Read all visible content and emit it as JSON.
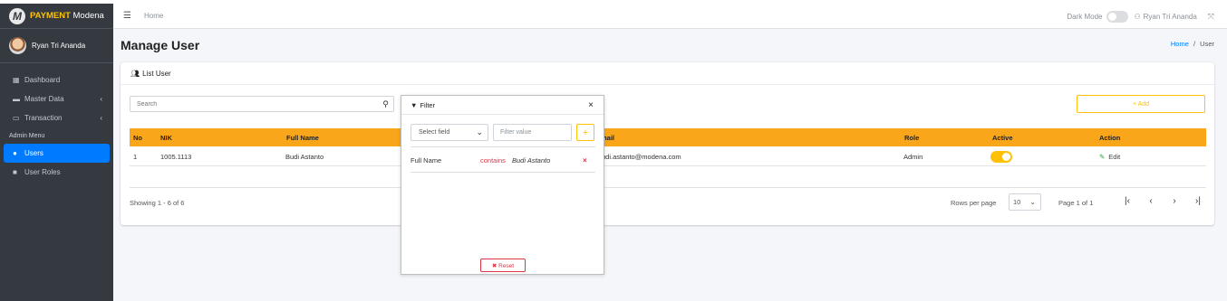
{
  "sidebar": {
    "brand_logo": "M",
    "brand_strong": "PAYMENT",
    "brand_rest": " Modena",
    "user_name": "Ryan Tri Ananda",
    "items": [
      {
        "label": "Dashboard",
        "icon": "grid-icon"
      },
      {
        "label": "Master Data",
        "icon": "car-icon"
      },
      {
        "label": "Transaction",
        "icon": "card-icon"
      }
    ],
    "section_header": "Admin Menu",
    "admin_items": [
      {
        "label": "Users",
        "icon": "users-icon",
        "active": true
      },
      {
        "label": "User Roles",
        "icon": "lock-icon",
        "active": false
      }
    ]
  },
  "topbar": {
    "home": "Home",
    "dark_mode_label": "Dark Mode",
    "user_name": "Ryan Tri Ananda"
  },
  "page": {
    "title": "Manage User",
    "breadcrumb_home": "Home",
    "breadcrumb_sep": "/",
    "breadcrumb_current": "User"
  },
  "card": {
    "title": "List User",
    "search_placeholder": "Search",
    "add_label": "+ Add"
  },
  "table": {
    "columns": [
      "No",
      "NIK",
      "Full Name",
      "Email",
      "Role",
      "Active",
      "Action"
    ],
    "email_header_visible": "mail",
    "rows": [
      {
        "no": "1",
        "nik": "1005.1113",
        "full_name": "Budi Astanto",
        "email_visible": "udi.astanto@modena.com",
        "role": "Admin",
        "active": true,
        "action": "Edit"
      }
    ]
  },
  "footer": {
    "showing": "Showing 1 - 6 of 6",
    "rows_per_page_label": "Rows per page",
    "rows_per_page_value": "10",
    "page_info": "Page 1 of 1"
  },
  "filter": {
    "title": "Filter",
    "close": "×",
    "field_placeholder": "Select field",
    "value_placeholder": "Filter value",
    "add": "+",
    "rule_field": "Full Name",
    "rule_op": "contains",
    "rule_value": "Budi Astanto",
    "rule_remove": "×",
    "reset_label": "✖ Reset"
  },
  "colors": {
    "accent": "#f9a61a",
    "primary": "#007bff",
    "danger": "#dc3545",
    "sidebar_bg": "#343a40"
  }
}
